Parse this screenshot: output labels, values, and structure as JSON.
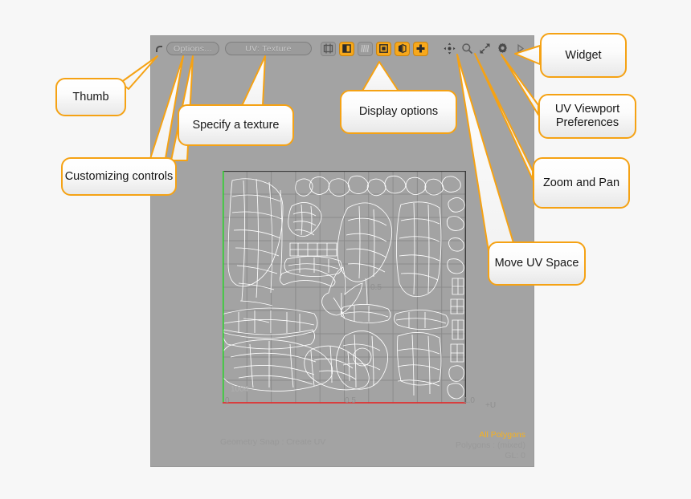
{
  "app": {
    "toolbar": {
      "thumb_label": "Thumb",
      "options_label": "Options...",
      "texture_label": "UV: Texture",
      "display_buttons": [
        {
          "name": "show-uv-border-icon",
          "state": "off",
          "label": "UV Border"
        },
        {
          "name": "show-uv-texture-icon",
          "state": "on",
          "label": "Texture"
        },
        {
          "name": "show-shading-icon",
          "state": "off",
          "label": "Shading"
        },
        {
          "name": "show-image-icon",
          "state": "on",
          "label": "Image"
        },
        {
          "name": "show-mirror-icon",
          "state": "on",
          "label": "Mirror"
        },
        {
          "name": "show-center-icon",
          "state": "on",
          "label": "Center"
        }
      ],
      "right_tools": [
        {
          "name": "move-uv-space-icon",
          "label": "Move UV Space"
        },
        {
          "name": "zoom-and-pan-icon",
          "label": "Zoom and Pan"
        },
        {
          "name": "uv-viewport-preferences-icon",
          "label": "UV Viewport Preferences"
        },
        {
          "name": "widget-gear-icon",
          "label": "Widget Settings"
        },
        {
          "name": "widget-arrow-icon",
          "label": "Widget"
        }
      ]
    },
    "viewport": {
      "axis_labels": {
        "origin": "0",
        "u_half": "0.5",
        "u_one": "1.0",
        "v_half": "0.5",
        "u_axis_name": "+U",
        "watermark": "1004"
      },
      "status": {
        "left": "Geometry Snap : Create UV",
        "all_polygons": "All Polygons",
        "polygons": "Polygons : (mixed)",
        "gl": "GL: 0"
      }
    }
  },
  "callouts": [
    {
      "id": "thumb",
      "text": "Thumb"
    },
    {
      "id": "specify-texture",
      "text": "Specify a texture"
    },
    {
      "id": "customizing",
      "text": "Customizing controls"
    },
    {
      "id": "display-options",
      "text": "Display options"
    },
    {
      "id": "widget",
      "text": "Widget"
    },
    {
      "id": "uv-viewport-prefs",
      "text": "UV Viewport\nPreferences"
    },
    {
      "id": "zoom-and-pan",
      "text": "Zoom and Pan"
    },
    {
      "id": "move-uv-space",
      "text": "Move UV Space"
    }
  ],
  "colors": {
    "panel_bg": "#a3a3a3",
    "accent_orange": "#f5a214",
    "icon_on": "#f7a81b",
    "u_axis_red": "#e03030",
    "v_axis_green": "#2fd02f",
    "grid_line": "#8b8b8b",
    "uv_wire": "#ffffff",
    "callout_border": "#f5a214",
    "status_gray": "#999999",
    "status_yellow": "#f6b120"
  }
}
